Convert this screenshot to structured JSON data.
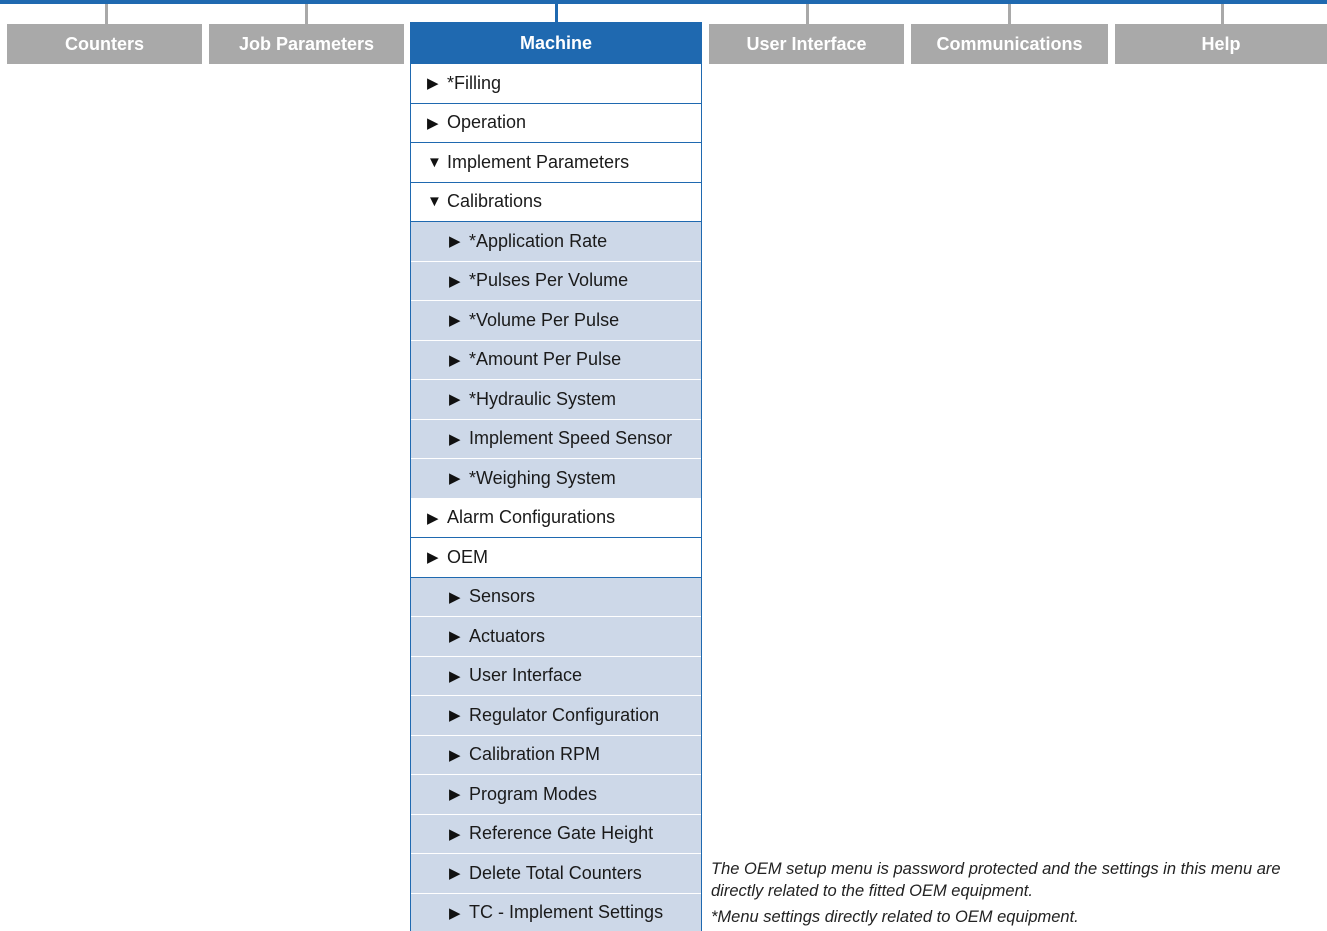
{
  "tabs": {
    "counters": "Counters",
    "job_parameters": "Job Parameters",
    "machine": "Machine",
    "user_interface": "User Interface",
    "communications": "Communications",
    "help": "Help"
  },
  "icons": {
    "collapsed": "▶",
    "expanded": "▼"
  },
  "menu": [
    {
      "label": "*Filling",
      "state": "collapsed"
    },
    {
      "label": "Operation",
      "state": "collapsed"
    },
    {
      "label": "Implement Parameters",
      "state": "expanded"
    },
    {
      "label": "Calibrations",
      "state": "expanded"
    },
    {
      "label": "*Application Rate",
      "state": "collapsed",
      "sub": true
    },
    {
      "label": "*Pulses Per Volume",
      "state": "collapsed",
      "sub": true
    },
    {
      "label": "*Volume Per Pulse",
      "state": "collapsed",
      "sub": true
    },
    {
      "label": "*Amount Per Pulse",
      "state": "collapsed",
      "sub": true
    },
    {
      "label": "*Hydraulic System",
      "state": "collapsed",
      "sub": true
    },
    {
      "label": "Implement Speed Sensor",
      "state": "collapsed",
      "sub": true
    },
    {
      "label": "*Weighing System",
      "state": "collapsed",
      "sub": true
    },
    {
      "label": "Alarm Configurations",
      "state": "collapsed"
    },
    {
      "label": "OEM",
      "state": "collapsed"
    },
    {
      "label": "Sensors",
      "state": "collapsed",
      "sub": true
    },
    {
      "label": "Actuators",
      "state": "collapsed",
      "sub": true
    },
    {
      "label": "User Interface",
      "state": "collapsed",
      "sub": true
    },
    {
      "label": "Regulator Configuration",
      "state": "collapsed",
      "sub": true
    },
    {
      "label": "Calibration RPM",
      "state": "collapsed",
      "sub": true
    },
    {
      "label": "Program Modes",
      "state": "collapsed",
      "sub": true
    },
    {
      "label": "Reference Gate Height",
      "state": "collapsed",
      "sub": true
    },
    {
      "label": "Delete Total Counters",
      "state": "collapsed",
      "sub": true
    },
    {
      "label": "TC - Implement Settings",
      "state": "collapsed",
      "sub": true
    }
  ],
  "notes": {
    "oem": "The OEM setup menu is password protected and the settings in this menu are directly related to the fitted OEM equipment.",
    "asterisk": "*Menu settings directly related to OEM equipment."
  },
  "colors": {
    "accent": "#1f69b0",
    "tab_inactive": "#a9a9a9",
    "submenu_bg": "#cdd8e8"
  }
}
